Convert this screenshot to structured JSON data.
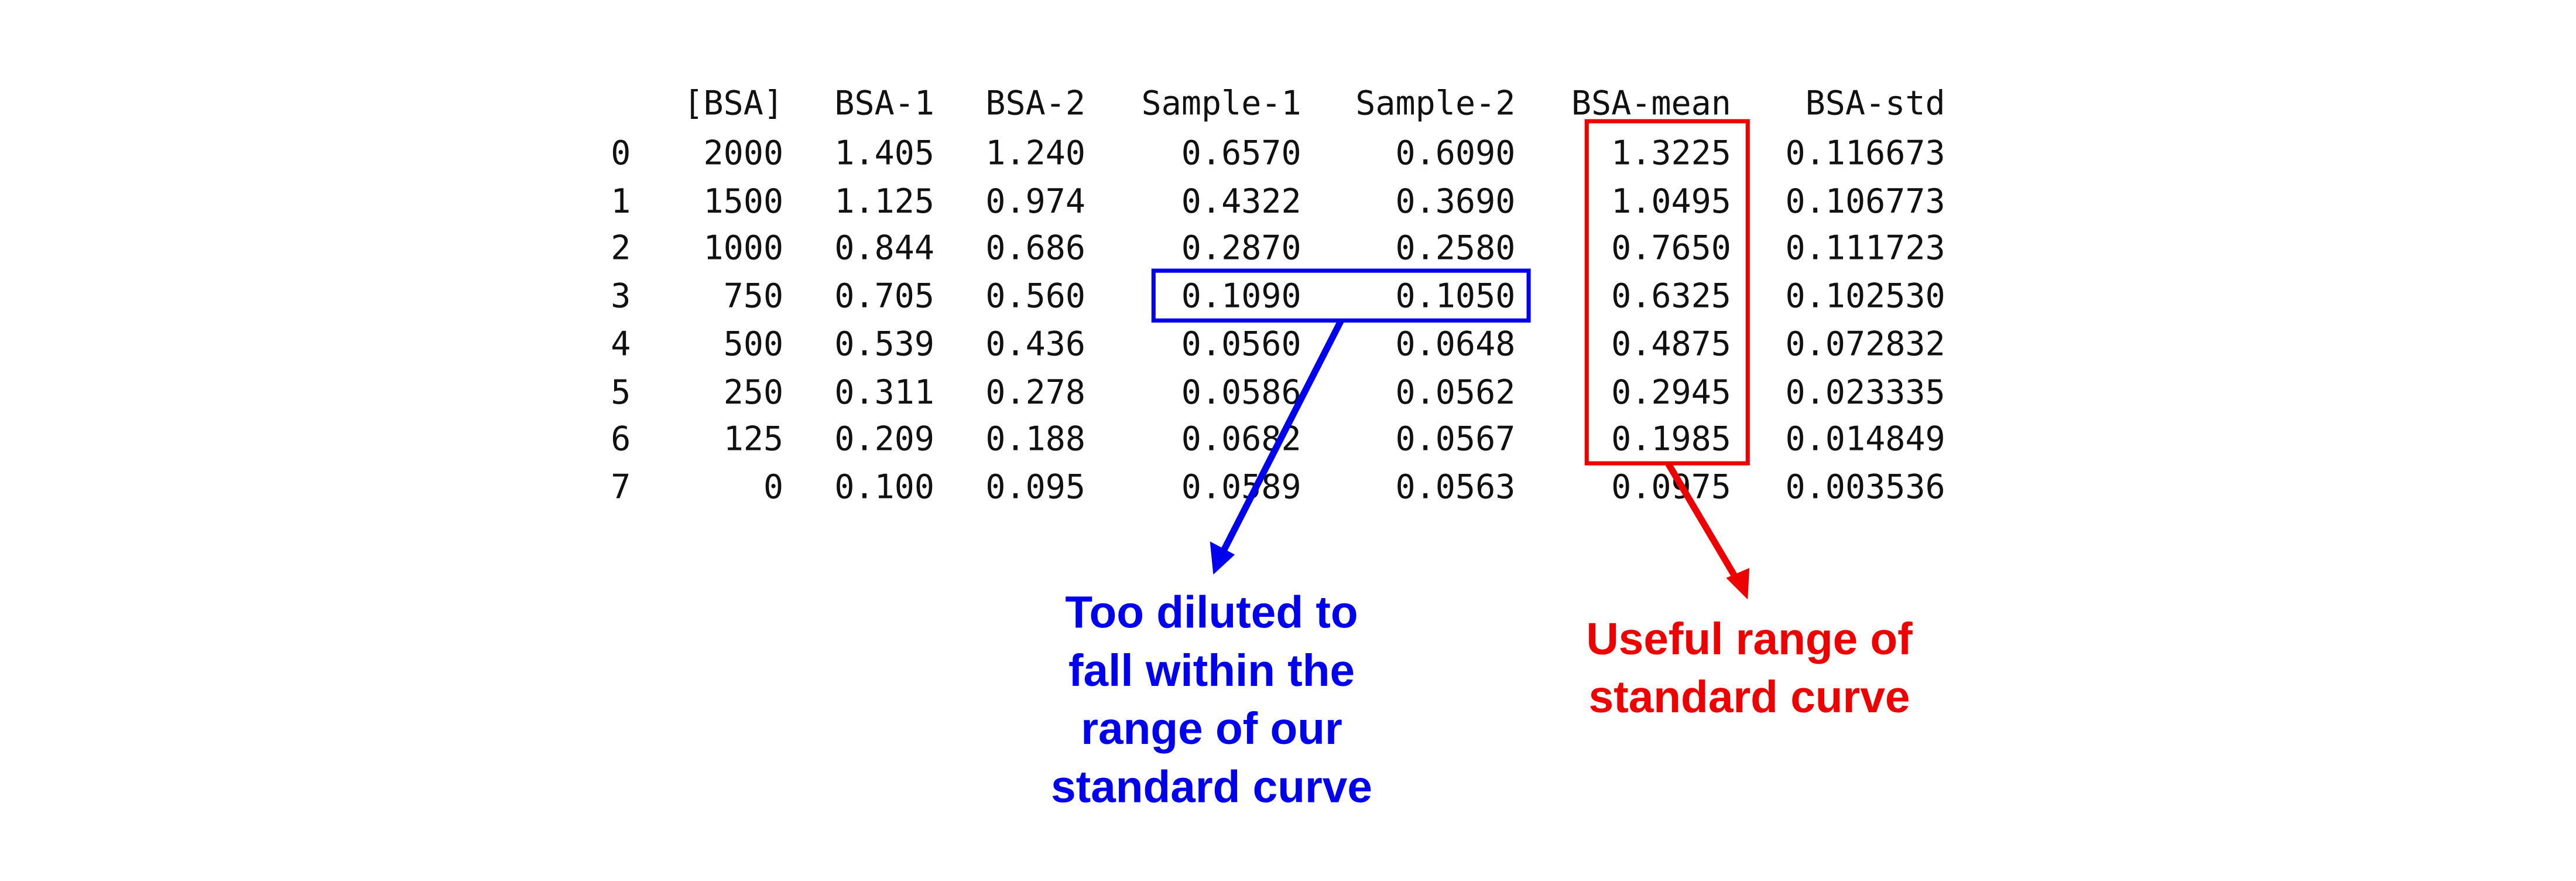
{
  "table": {
    "columns": [
      "[BSA]",
      "BSA-1",
      "BSA-2",
      "Sample-1",
      "Sample-2",
      "BSA-mean",
      "BSA-std"
    ],
    "rows": [
      {
        "index": "0",
        "cells": [
          "2000",
          "1.405",
          "1.240",
          "0.6570",
          "0.6090",
          "1.3225",
          "0.116673"
        ]
      },
      {
        "index": "1",
        "cells": [
          "1500",
          "1.125",
          "0.974",
          "0.4322",
          "0.3690",
          "1.0495",
          "0.106773"
        ]
      },
      {
        "index": "2",
        "cells": [
          "1000",
          "0.844",
          "0.686",
          "0.2870",
          "0.2580",
          "0.7650",
          "0.111723"
        ]
      },
      {
        "index": "3",
        "cells": [
          "750",
          "0.705",
          "0.560",
          "0.1090",
          "0.1050",
          "0.6325",
          "0.102530"
        ]
      },
      {
        "index": "4",
        "cells": [
          "500",
          "0.539",
          "0.436",
          "0.0560",
          "0.0648",
          "0.4875",
          "0.072832"
        ]
      },
      {
        "index": "5",
        "cells": [
          "250",
          "0.311",
          "0.278",
          "0.0586",
          "0.0562",
          "0.2945",
          "0.023335"
        ]
      },
      {
        "index": "6",
        "cells": [
          "125",
          "0.209",
          "0.188",
          "0.0682",
          "0.0567",
          "0.1985",
          "0.014849"
        ]
      },
      {
        "index": "7",
        "cells": [
          "0",
          "0.100",
          "0.095",
          "0.0589",
          "0.0563",
          "0.0975",
          "0.003536"
        ]
      }
    ]
  },
  "annotations": {
    "blue_note": {
      "lines": [
        "Too diluted to",
        "fall within the",
        "range of our",
        "standard curve"
      ],
      "color": "#0000ee"
    },
    "red_note": {
      "lines": [
        "Useful range of",
        "standard curve"
      ],
      "color": "#ee0000"
    }
  }
}
